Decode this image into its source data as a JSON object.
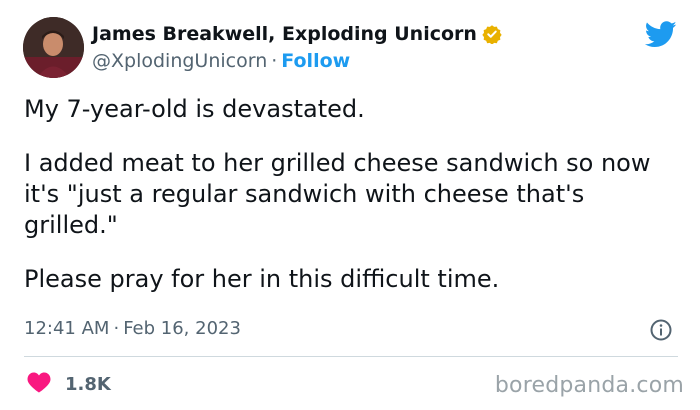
{
  "author": {
    "display_name": "James Breakwell, Exploding Unicorn",
    "handle": "@XplodingUnicorn",
    "separator": "·",
    "follow_label": "Follow",
    "verified_color": "#e9b100"
  },
  "tweet": {
    "paragraphs": [
      "My 7-year-old is devastated.",
      "I added meat to her grilled cheese sandwich so now it's \"just a regular sandwich with cheese that's grilled.\"",
      "Please pray for her in this difficult time."
    ],
    "time": "12:41 AM",
    "separator": "·",
    "date": "Feb 16, 2023"
  },
  "engagement": {
    "likes": "1.8K",
    "like_color": "#f91880"
  },
  "watermark": "boredpanda.com",
  "colors": {
    "brand_blue": "#1d9bf0",
    "text": "#0f1419",
    "muted": "#536471"
  },
  "icons": [
    "twitter-bird-icon",
    "verified-badge-icon",
    "info-icon",
    "heart-icon"
  ]
}
